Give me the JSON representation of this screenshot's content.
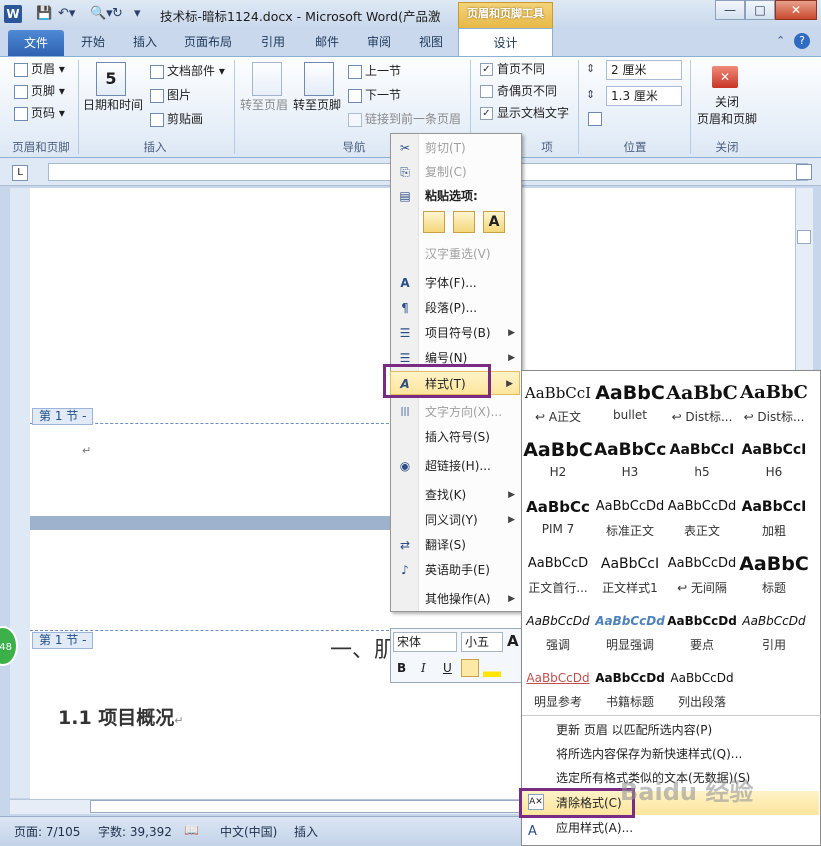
{
  "window": {
    "title": "技术标-暗标1124.docx - Microsoft Word(产品激",
    "context_tab": "页眉和页脚工具",
    "word_icon": "W",
    "minimize": "—",
    "maximize": "□",
    "close": "✕",
    "help": "?",
    "ribbon_min": "⌃"
  },
  "tabs": [
    "文件",
    "开始",
    "插入",
    "页面布局",
    "引用",
    "邮件",
    "审阅",
    "视图",
    "设计"
  ],
  "ribbon": {
    "hf_items": [
      "页眉",
      "页脚",
      "页码"
    ],
    "hf_group": "页眉和页脚",
    "insert_date": "日期和时间",
    "insert_items": [
      "文档部件",
      "图片",
      "剪贴画"
    ],
    "insert_group": "插入",
    "nav_header": "转至页眉",
    "nav_footer": "转至页脚",
    "nav_prev": "上一节",
    "nav_next": "下一节",
    "nav_link": "链接到前一条页眉",
    "nav_group": "导航",
    "options": [
      "首页不同",
      "奇偶页不同",
      "显示文档文字"
    ],
    "options_checked": [
      true,
      false,
      true
    ],
    "options_group": "项",
    "pos_header": "2 厘米",
    "pos_footer": "1.3 厘米",
    "pos_group": "位置",
    "close_label": "关闭\n页眉和页脚",
    "close_group": "关闭"
  },
  "doc": {
    "section_tag1": "第 1 节 -",
    "section_tag2": "第 1 节 -",
    "heading": "1.1 项目概况",
    "heading_mark": "↵",
    "big_heading": "一、肌",
    "para_mark": "↵"
  },
  "context_menu": [
    {
      "label": "剪切(T)",
      "icon": "✂",
      "disabled": true
    },
    {
      "label": "复制(C)",
      "icon": "⎘",
      "disabled": true
    },
    {
      "label": "粘贴选项:",
      "icon": "📋",
      "bold": true
    },
    {
      "label": "汉字重选(V)",
      "disabled": true
    },
    {
      "label": "字体(F)...",
      "icon": "A"
    },
    {
      "label": "段落(P)...",
      "icon": "¶"
    },
    {
      "label": "项目符号(B)",
      "icon": "☰",
      "sub": true
    },
    {
      "label": "编号(N)",
      "icon": "☰",
      "sub": true
    },
    {
      "label": "样式(T)",
      "icon": "A",
      "sub": true,
      "hot": true
    },
    {
      "label": "文字方向(X)...",
      "icon": "|||",
      "disabled": true
    },
    {
      "label": "插入符号(S)"
    },
    {
      "label": "超链接(H)...",
      "icon": "🌐"
    },
    {
      "label": "查找(K)",
      "sub": true
    },
    {
      "label": "同义词(Y)",
      "sub": true
    },
    {
      "label": "翻译(S)",
      "icon": "⇄"
    },
    {
      "label": "英语助手(E)",
      "icon": "♪"
    },
    {
      "label": "其他操作(A)",
      "sub": true
    }
  ],
  "paste_icons": [
    "A"
  ],
  "styles": [
    {
      "preview": "AaBbCcI",
      "name": "↩ A正文"
    },
    {
      "preview": "AaBbC",
      "name": "bullet"
    },
    {
      "preview": "AaBbC",
      "name": "↩ Dist标..."
    },
    {
      "preview": "AaBbC",
      "name": "↩ Dist标..."
    },
    {
      "preview": "AaBbC",
      "name": "H2"
    },
    {
      "preview": "AaBbCc",
      "name": "H3"
    },
    {
      "preview": "AaBbCcI",
      "name": "h5"
    },
    {
      "preview": "AaBbCcI",
      "name": "H6"
    },
    {
      "preview": "AaBbCc",
      "name": "PIM 7"
    },
    {
      "preview": "AaBbCcDd",
      "name": "标准正文"
    },
    {
      "preview": "AaBbCcDd",
      "name": "表正文"
    },
    {
      "preview": "AaBbCcI",
      "name": "加粗"
    },
    {
      "preview": "AaBbCcD",
      "name": "正文首行..."
    },
    {
      "preview": "AaBbCcI",
      "name": "正文样式1"
    },
    {
      "preview": "AaBbCcDd",
      "name": "↩ 无间隔"
    },
    {
      "preview": "AaBbC",
      "name": "标题"
    },
    {
      "preview": "AaBbCcDd",
      "name": "强调"
    },
    {
      "preview": "AaBbCcDd",
      "name": "明显强调"
    },
    {
      "preview": "AaBbCcDd",
      "name": "要点"
    },
    {
      "preview": "AaBbCcDd",
      "name": "引用"
    },
    {
      "preview": "AaBbCcDd",
      "name": "明显参考"
    },
    {
      "preview": "AaBbCcDd",
      "name": "书籍标题"
    },
    {
      "preview": "AaBbCcDd",
      "name": "列出段落"
    }
  ],
  "gallery_cmds": [
    "更新 页眉 以匹配所选内容(P)",
    "将所选内容保存为新快速样式(Q)...",
    "选定所有格式类似的文本(无数据)(S)",
    "清除格式(C)",
    "应用样式(A)..."
  ],
  "mini_toolbar": {
    "font": "宋体",
    "size": "小五",
    "grow": "A",
    "bold": "B",
    "italic": "I",
    "underline": "U"
  },
  "status": {
    "page": "页面: 7/105",
    "words": "字数: 39,392",
    "lang": "中文(中国)",
    "mode": "插入"
  },
  "badge": "48",
  "watermark": "Baidu 经验"
}
